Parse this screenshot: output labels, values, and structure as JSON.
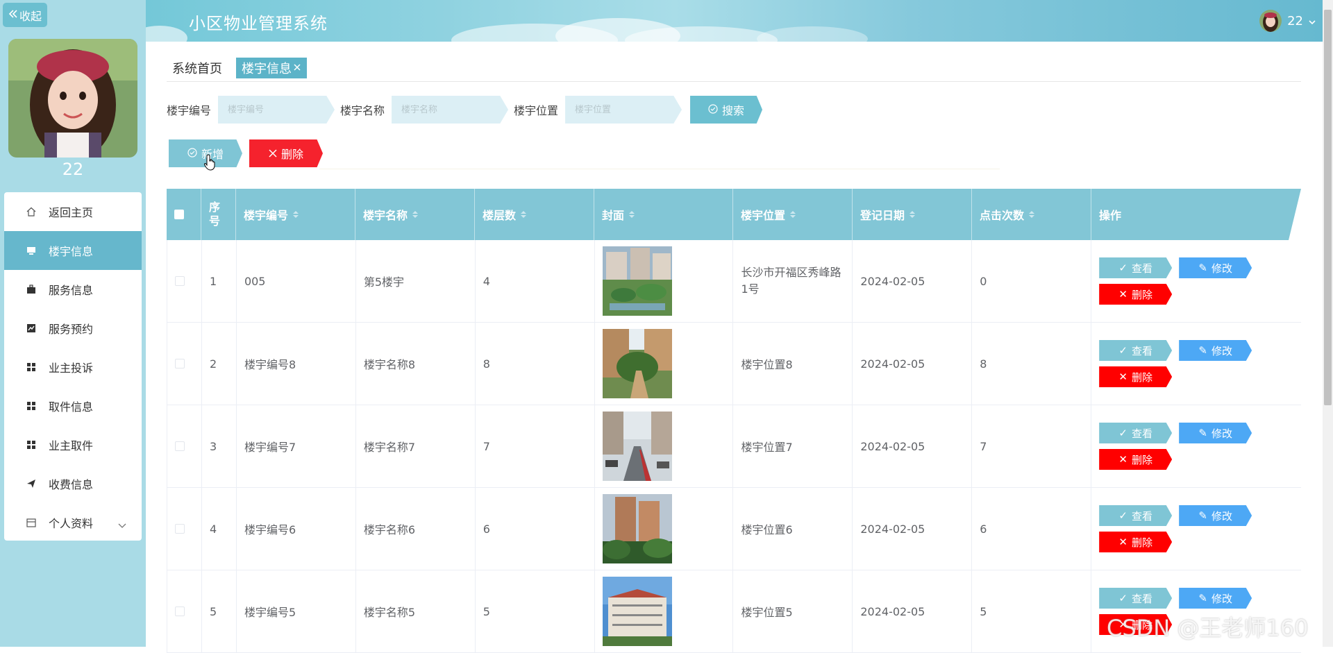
{
  "sidebar": {
    "collapse_label": "收起",
    "username": "22",
    "menu": [
      {
        "label": "返回主页",
        "icon": "home-icon",
        "active": false
      },
      {
        "label": "楼宇信息",
        "icon": "monitor-icon",
        "active": true
      },
      {
        "label": "服务信息",
        "icon": "briefcase-icon",
        "active": false
      },
      {
        "label": "服务预约",
        "icon": "chart-icon",
        "active": false
      },
      {
        "label": "业主投诉",
        "icon": "grid-icon",
        "active": false
      },
      {
        "label": "取件信息",
        "icon": "grid-icon",
        "active": false
      },
      {
        "label": "业主取件",
        "icon": "grid-icon",
        "active": false
      },
      {
        "label": "收费信息",
        "icon": "send-icon",
        "active": false
      },
      {
        "label": "个人资料",
        "icon": "calendar-icon",
        "active": false
      }
    ]
  },
  "header": {
    "title": "小区物业管理系统",
    "user": "22"
  },
  "breadcrumb": {
    "home": "系统首页",
    "current": "楼宇信息"
  },
  "search": {
    "fields": [
      {
        "label": "楼宇编号",
        "placeholder": "楼宇编号"
      },
      {
        "label": "楼宇名称",
        "placeholder": "楼宇名称"
      },
      {
        "label": "楼宇位置",
        "placeholder": "楼宇位置"
      }
    ],
    "button": "搜索"
  },
  "actions": {
    "add": "新增",
    "delete": "删除"
  },
  "table": {
    "headers": [
      "序号",
      "楼宇编号",
      "楼宇名称",
      "楼层数",
      "封面",
      "楼宇位置",
      "登记日期",
      "点击次数",
      "操作"
    ],
    "rows": [
      {
        "index": "1",
        "code": "005",
        "name": "第5楼宇",
        "floors": "4",
        "location": "长沙市开福区秀峰路1号",
        "date": "2024-02-05",
        "clicks": "0"
      },
      {
        "index": "2",
        "code": "楼宇编号8",
        "name": "楼宇名称8",
        "floors": "8",
        "location": "楼宇位置8",
        "date": "2024-02-05",
        "clicks": "8"
      },
      {
        "index": "3",
        "code": "楼宇编号7",
        "name": "楼宇名称7",
        "floors": "7",
        "location": "楼宇位置7",
        "date": "2024-02-05",
        "clicks": "7"
      },
      {
        "index": "4",
        "code": "楼宇编号6",
        "name": "楼宇名称6",
        "floors": "6",
        "location": "楼宇位置6",
        "date": "2024-02-05",
        "clicks": "6"
      },
      {
        "index": "5",
        "code": "楼宇编号5",
        "name": "楼宇名称5",
        "floors": "5",
        "location": "楼宇位置5",
        "date": "2024-02-05",
        "clicks": "5"
      }
    ],
    "row_actions": {
      "view": "查看",
      "edit": "修改",
      "delete": "删除"
    }
  },
  "watermark": "CSDN @王老师160",
  "colors": {
    "sidebar_bg": "#a9dbe6",
    "accent": "#66b7cc",
    "danger": "#f5222d",
    "edit": "#4da8f5"
  }
}
